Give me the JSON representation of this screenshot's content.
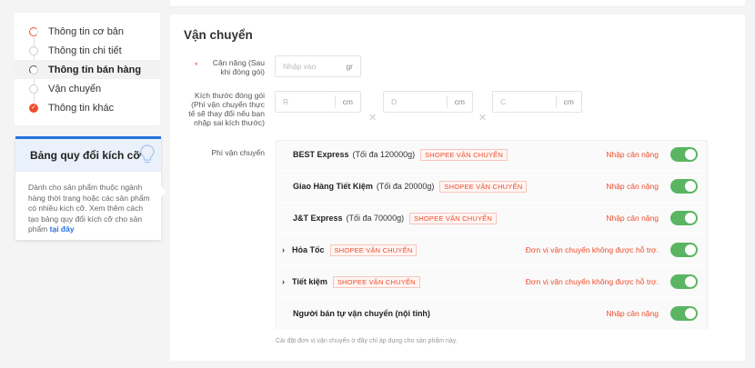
{
  "steps": [
    {
      "label": "Thông tin cơ bản",
      "state": "half-red",
      "active": false
    },
    {
      "label": "Thông tin chi tiết",
      "state": "empty",
      "active": false
    },
    {
      "label": "Thông tin bán hàng",
      "state": "half-dark",
      "active": true
    },
    {
      "label": "Vận chuyển",
      "state": "empty",
      "active": false
    },
    {
      "label": "Thông tin khác",
      "state": "check",
      "active": false
    }
  ],
  "size_chart": {
    "title": "Bảng quy đổi kích cỡ",
    "description": "Dành cho sản phẩm thuộc ngành hàng thời trang hoặc các sản phẩm có nhiều kích cỡ. Xem thêm cách tạo bảng quy đổi kích cỡ cho sản phẩm",
    "link": "tại đây"
  },
  "shipping": {
    "title": "Vận chuyển",
    "weight_label": "Cân nặng (Sau khi đóng gói)",
    "weight_placeholder": "Nhập vào",
    "weight_unit": "gr",
    "size_label": "Kích thước đóng gói (Phí vận chuyển thực tế sẽ thay đổi nếu bạn nhập sai kích thước)",
    "dims": [
      {
        "placeholder": "R",
        "unit": "cm"
      },
      {
        "placeholder": "D",
        "unit": "cm"
      },
      {
        "placeholder": "C",
        "unit": "cm"
      }
    ],
    "fee_label": "Phí vận chuyển",
    "carriers": [
      {
        "name": "BEST Express",
        "limit": "(Tối đa 120000g)",
        "tag": "SHOPEE VẬN CHUYỂN",
        "status": "Nhập cân nặng",
        "expandable": false,
        "enabled": true
      },
      {
        "name": "Giao Hàng Tiết Kiệm",
        "limit": "(Tối đa 20000g)",
        "tag": "SHOPEE VẬN CHUYỂN",
        "status": "Nhập cân nặng",
        "expandable": false,
        "enabled": true
      },
      {
        "name": "J&T Express",
        "limit": "(Tối đa 70000g)",
        "tag": "SHOPEE VẬN CHUYỂN",
        "status": "Nhập cân nặng",
        "expandable": false,
        "enabled": true
      },
      {
        "name": "Hỏa Tốc",
        "limit": "",
        "tag": "SHOPEE VẬN CHUYỂN",
        "status": "Đơn vị vận chuyển không được hỗ trợ.",
        "expandable": true,
        "enabled": true
      },
      {
        "name": "Tiết kiệm",
        "limit": "",
        "tag": "SHOPEE VẬN CHUYỂN",
        "status": "Đơn vị vận chuyển không được hỗ trợ.",
        "expandable": true,
        "enabled": true
      },
      {
        "name": "Người bán tự vận chuyển (nội tỉnh)",
        "limit": "",
        "tag": "",
        "status": "Nhập cân nặng",
        "expandable": false,
        "enabled": true
      }
    ],
    "note": "Cài đặt đơn vị vận chuyển ở đây chỉ áp dụng cho sản phẩm này."
  },
  "colors": {
    "accent": "#ee4d2d",
    "toggle_on": "#5ab562",
    "link": "#2673dd"
  }
}
